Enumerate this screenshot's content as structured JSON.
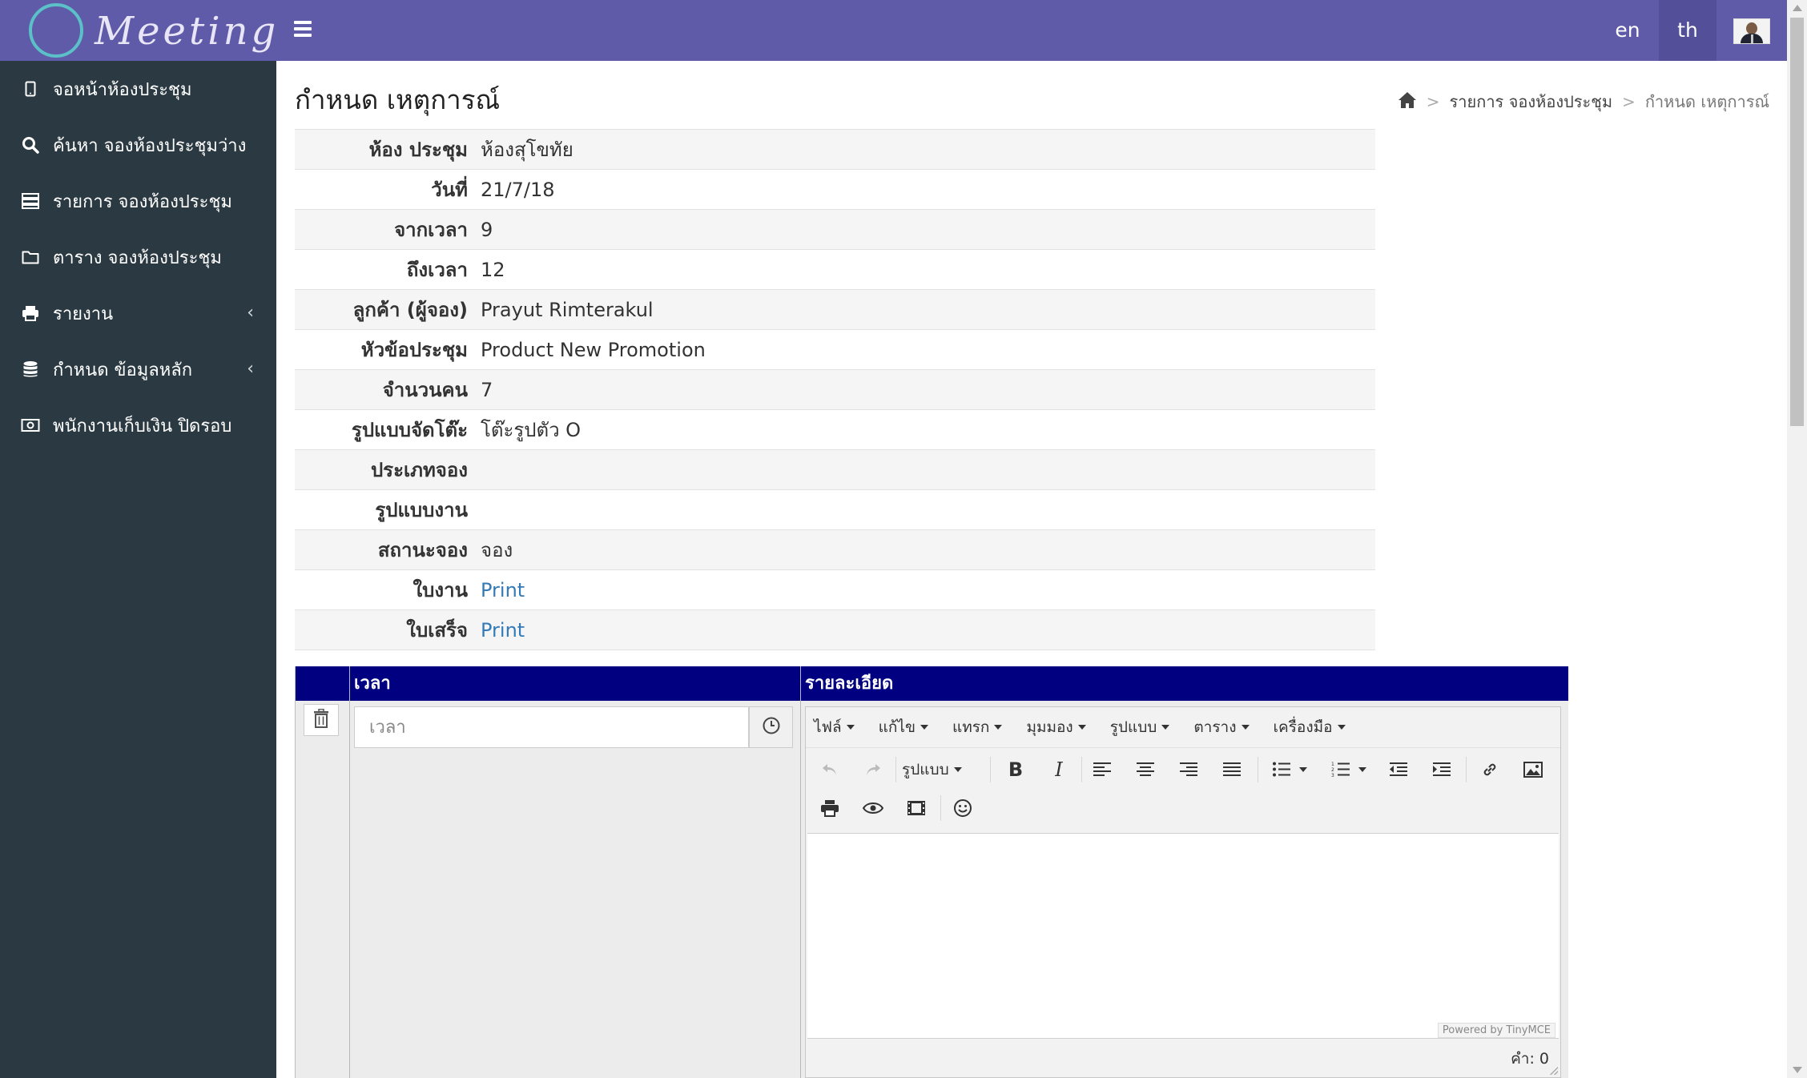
{
  "brand": {
    "logo_text": "Meeting"
  },
  "topbar": {
    "lang_en": "en",
    "lang_th": "th"
  },
  "sidebar": {
    "items": [
      {
        "label": "จอหน้าห้องประชุม",
        "icon": "tablet-icon"
      },
      {
        "label": "ค้นหา จองห้องประชุมว่าง",
        "icon": "search-icon"
      },
      {
        "label": "รายการ จองห้องประชุม",
        "icon": "list-icon"
      },
      {
        "label": "ตาราง จองห้องประชุม",
        "icon": "folder-icon"
      },
      {
        "label": "รายงาน",
        "icon": "printer-icon",
        "expandable": true
      },
      {
        "label": "กำหนด ข้อมูลหลัก",
        "icon": "database-icon",
        "expandable": true
      },
      {
        "label": "พนักงานเก็บเงิน ปิดรอบ",
        "icon": "money-icon"
      }
    ],
    "chevron": "‹"
  },
  "page": {
    "title": "กำหนด เหตุการณ์",
    "breadcrumb": {
      "link": "รายการ จองห้องประชุม",
      "separator": ">",
      "current": "กำหนด เหตุการณ์"
    }
  },
  "details": [
    {
      "label": "ห้อง ประชุม",
      "value": "ห้องสุโขทัย"
    },
    {
      "label": "วันที่",
      "value": "21/7/18"
    },
    {
      "label": "จากเวลา",
      "value": "9"
    },
    {
      "label": "ถึงเวลา",
      "value": "12"
    },
    {
      "label": "ลูกค้า (ผู้จอง)",
      "value": "Prayut Rimterakul"
    },
    {
      "label": "หัวข้อประชุม",
      "value": "Product New Promotion"
    },
    {
      "label": "จำนวนคน",
      "value": "7"
    },
    {
      "label": "รูปแบบจัดโต๊ะ",
      "value": "โต๊ะรูปตัว O"
    },
    {
      "label": "ประเภทจอง",
      "value": ""
    },
    {
      "label": "รูปแบบงาน",
      "value": ""
    },
    {
      "label": "สถานะจอง",
      "value": "จอง"
    },
    {
      "label": "ใบงาน",
      "value": "Print",
      "link": true
    },
    {
      "label": "ใบเสร็จ",
      "value": "Print",
      "link": true
    }
  ],
  "grid": {
    "col_time": "เวลา",
    "col_detail": "รายละเอียด",
    "time_placeholder": "เวลา",
    "time_value": "",
    "header_color": "#000080"
  },
  "editor": {
    "menu": [
      "ไฟล์",
      "แก้ไข",
      "แทรก",
      "มุมมอง",
      "รูปแบบ",
      "ตาราง",
      "เครื่องมือ"
    ],
    "format_label": "รูปแบบ",
    "powered_by": "Powered by TinyMCE",
    "word_count": "คำ: 0"
  },
  "colors": {
    "topbar": "#5f5ba8",
    "sidebar": "#2b3a42",
    "link": "#337ab7"
  }
}
